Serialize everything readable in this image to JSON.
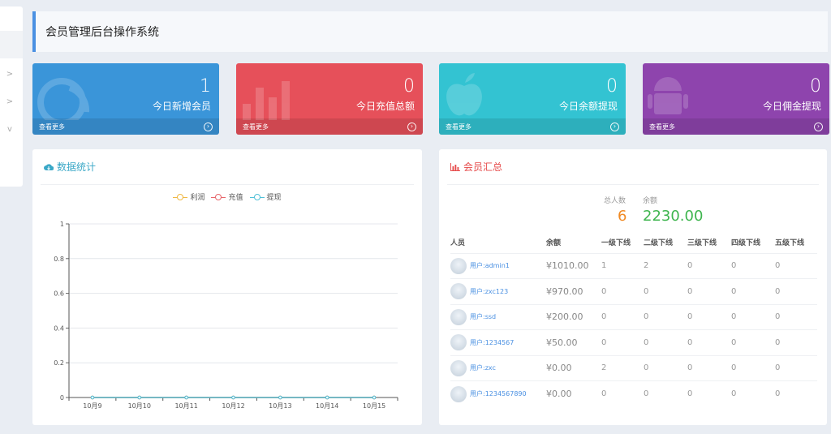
{
  "header": {
    "title": "会员管理后台操作系统"
  },
  "sidebar": {
    "chevrons": [
      ">",
      ">",
      "v"
    ]
  },
  "cards": [
    {
      "value": "1",
      "label": "今日新增会员",
      "more": "查看更多",
      "color": "#3a95d9",
      "icon": "gauge-icon"
    },
    {
      "value": "0",
      "label": "今日充值总额",
      "more": "查看更多",
      "color": "#e6505a",
      "icon": "bar-chart-icon"
    },
    {
      "value": "0",
      "label": "今日余额提现",
      "more": "查看更多",
      "color": "#33c3d2",
      "icon": "apple-icon"
    },
    {
      "value": "0",
      "label": "今日佣金提现",
      "more": "查看更多",
      "color": "#8e44ad",
      "icon": "android-icon"
    }
  ],
  "stats_panel": {
    "title": "数据统计",
    "legend": [
      "利润",
      "充值",
      "提现"
    ]
  },
  "chart_data": {
    "type": "line",
    "categories": [
      "10月9",
      "10月10",
      "10月11",
      "10月12",
      "10月13",
      "10月14",
      "10月15"
    ],
    "series": [
      {
        "name": "利润",
        "values": [
          0,
          0,
          0,
          0,
          0,
          0,
          0
        ],
        "color": "#f0b843"
      },
      {
        "name": "充值",
        "values": [
          0,
          0,
          0,
          0,
          0,
          0,
          0
        ],
        "color": "#e7656a"
      },
      {
        "name": "提现",
        "values": [
          0,
          0,
          0,
          0,
          0,
          0,
          0
        ],
        "color": "#4fc0d8"
      }
    ],
    "ylim": [
      0,
      1
    ],
    "yticks": [
      "0",
      "0.2",
      "0.4",
      "0.6",
      "0.8",
      "1"
    ],
    "grid": true,
    "legend_position": "top"
  },
  "members_panel": {
    "title": "会员汇总",
    "total_label": "总人数",
    "total_value": "6",
    "balance_label": "余额",
    "balance_value": "2230.00",
    "columns": [
      "人员",
      "余额",
      "一级下线",
      "二级下线",
      "三级下线",
      "四级下线",
      "五级下线"
    ],
    "rows": [
      {
        "user": "用户:admin1",
        "balance": "¥1010.00",
        "l1": "1",
        "l2": "2",
        "l3": "0",
        "l4": "0",
        "l5": "0"
      },
      {
        "user": "用户:zxc123",
        "balance": "¥970.00",
        "l1": "0",
        "l2": "0",
        "l3": "0",
        "l4": "0",
        "l5": "0"
      },
      {
        "user": "用户:ssd",
        "balance": "¥200.00",
        "l1": "0",
        "l2": "0",
        "l3": "0",
        "l4": "0",
        "l5": "0"
      },
      {
        "user": "用户:1234567",
        "balance": "¥50.00",
        "l1": "0",
        "l2": "0",
        "l3": "0",
        "l4": "0",
        "l5": "0"
      },
      {
        "user": "用户:zxc",
        "balance": "¥0.00",
        "l1": "2",
        "l2": "0",
        "l3": "0",
        "l4": "0",
        "l5": "0"
      },
      {
        "user": "用户:1234567890",
        "balance": "¥0.00",
        "l1": "0",
        "l2": "0",
        "l3": "0",
        "l4": "0",
        "l5": "0"
      }
    ]
  }
}
